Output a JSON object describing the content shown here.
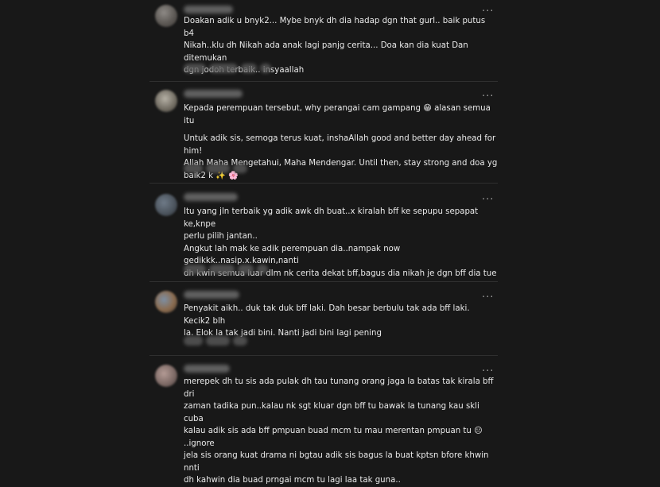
{
  "comments": [
    {
      "lines": [
        "Doakan adik u bnyk2... Mybe bnyk dh dia hadap dgn that gurl.. baik putus b4",
        "Nikah..klu dh Nikah ada anak lagi panjg cerita... Doa kan dia kuat Dan ditemukan",
        "dgn jodoh terbaik.. insyaallah"
      ]
    },
    {
      "lines": [
        "Kepada perempuan tersebut, why perangai cam gampang 😁 alasan semua itu",
        "Untuk adik sis, semoga terus kuat, inshaAllah good and better day ahead for him!",
        "Allah Maha Mengetahui, Maha Mendengar. Until then, stay strong and doa yg",
        "baik2 k ✨ 🌸"
      ]
    },
    {
      "lines": [
        "Itu yang jln terbaik yg adik awk dh buat..x kiralah bff ke sepupu sepapat ke,knpe",
        "perlu pilih jantan..",
        "Angkut lah mak ke adik perempuan dia..nampak now gedikkk..nasip.x.kawin,nanti",
        "dh kwin semua luar dlm nk cerita dekat bff,bagus dia nikah je dgn bff dia tue"
      ]
    },
    {
      "lines": [
        "Penyakit aikh.. duk tak duk bff laki. Dah besar berbulu tak ada bff laki. Kecik2 blh",
        "la. Elok la tak jadi bini. Nanti jadi bini lagi pening"
      ]
    },
    {
      "lines": [
        "merepek dh tu sis ada pulak dh tau tunang orang jaga la batas tak kirala bff dri",
        "zaman tadika pun..kalau nk sgt kluar dgn bff tu bawak la tunang kau skli cuba",
        "kalau adik sis ada bff pmpuan buad mcm tu mau merentan pmpuan tu 😑 ..ignore",
        "jela sis orang kuat drama ni bgtau adik sis bagus la buat kptsn bfore khwin nnti",
        "dh kahwin dia buad prngai mcm tu lagi laa tak guna.."
      ]
    }
  ],
  "more_glyph": "...",
  "icons": {
    "more": "more-options-icon",
    "avatar": "avatar"
  },
  "colors": {
    "background": "#181818",
    "text": "#eaeaea",
    "separator": "#2f2f2f"
  }
}
